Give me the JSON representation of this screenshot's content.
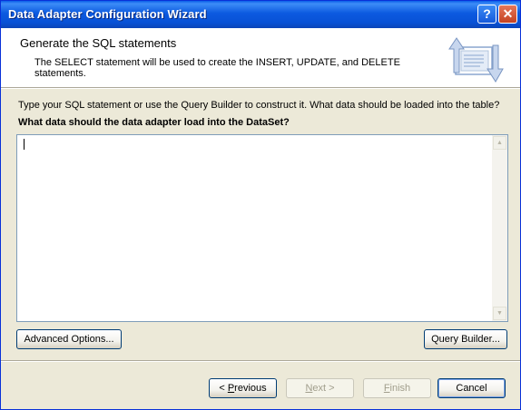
{
  "window": {
    "title": "Data Adapter Configuration Wizard",
    "help_glyph": "?",
    "close_glyph": "✕"
  },
  "header": {
    "title": "Generate the SQL statements",
    "description": "The SELECT statement will be used to create the INSERT, UPDATE, and DELETE statements.",
    "icon": "wizard-exchange-icon"
  },
  "body": {
    "instructions": "Type your SQL statement or use the Query Builder to construct it. What data should be loaded into the table?",
    "question": "What data should the data adapter load into the DataSet?",
    "sql_text": ""
  },
  "buttons": {
    "advanced_options": "Advanced Options...",
    "query_builder": "Query Builder...",
    "previous_prefix": "< ",
    "previous_mnemonic": "P",
    "previous_rest": "revious",
    "next_mnemonic": "N",
    "next_rest": "ext >",
    "finish_mnemonic": "F",
    "finish_rest": "inish",
    "cancel": "Cancel"
  },
  "scrollbar": {
    "up_glyph": "▲",
    "down_glyph": "▼"
  },
  "colors": {
    "title_bar": "#0a5fe8",
    "dialog_bg": "#ece9d8",
    "button_border": "#003c74"
  }
}
